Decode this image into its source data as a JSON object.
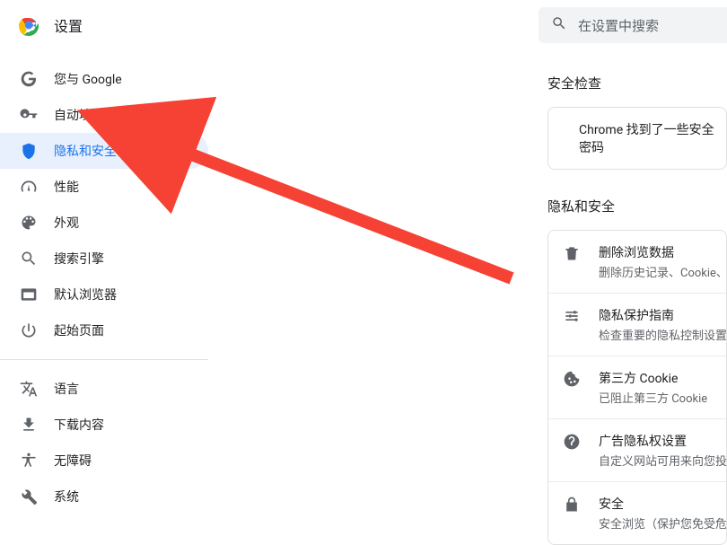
{
  "header": {
    "title": "设置"
  },
  "search": {
    "placeholder": "在设置中搜索"
  },
  "sidebar": {
    "items": [
      {
        "label": "您与 Google"
      },
      {
        "label": "自动填充和密码"
      },
      {
        "label": "隐私和安全"
      },
      {
        "label": "性能"
      },
      {
        "label": "外观"
      },
      {
        "label": "搜索引擎"
      },
      {
        "label": "默认浏览器"
      },
      {
        "label": "起始页面"
      }
    ],
    "items2": [
      {
        "label": "语言"
      },
      {
        "label": "下载内容"
      },
      {
        "label": "无障碍"
      },
      {
        "label": "系统"
      }
    ]
  },
  "sections": {
    "security_check": "安全检查",
    "privacy_security": "隐私和安全"
  },
  "security_card": {
    "line1": "Chrome 找到了一些安全",
    "line2": "密码"
  },
  "privacy_rows": [
    {
      "title": "删除浏览数据",
      "sub": "删除历史记录、Cookie、"
    },
    {
      "title": "隐私保护指南",
      "sub": "检查重要的隐私控制设置"
    },
    {
      "title": "第三方 Cookie",
      "sub": "已阻止第三方 Cookie"
    },
    {
      "title": "广告隐私权设置",
      "sub": "自定义网站可用来向您投"
    },
    {
      "title": "安全",
      "sub": "安全浏览（保护您免受危"
    }
  ]
}
